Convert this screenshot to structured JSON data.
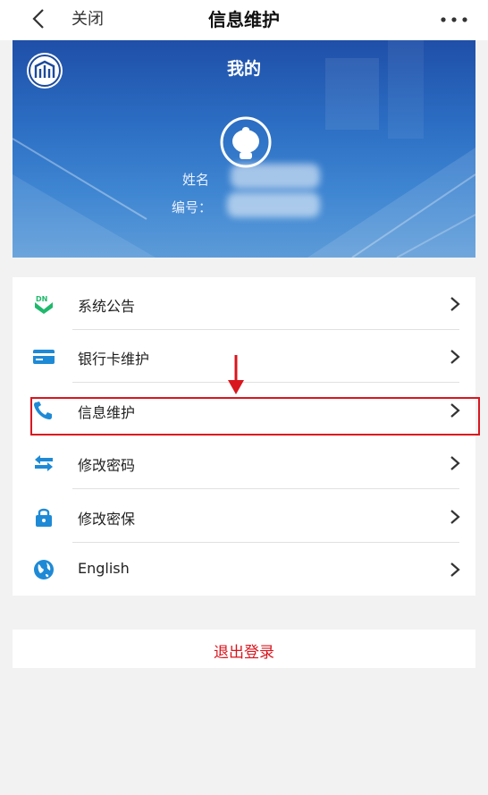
{
  "nav": {
    "close_label": "关闭",
    "title": "信息维护"
  },
  "profile": {
    "banner_title": "我的",
    "name_label": "姓名",
    "code_label": "编号："
  },
  "menu": [
    {
      "label": "系统公告",
      "icon": "announcement-icon"
    },
    {
      "label": "银行卡维护",
      "icon": "bank-card-icon"
    },
    {
      "label": "信息维护",
      "icon": "phone-icon"
    },
    {
      "label": "修改密码",
      "icon": "swap-arrows-icon"
    },
    {
      "label": "修改密保",
      "icon": "lock-icon"
    },
    {
      "label": "English",
      "icon": "globe-icon"
    }
  ],
  "logout": {
    "label": "退出登录"
  },
  "colors": {
    "accent": "#1e8ad6",
    "danger": "#d9161e",
    "banner": "#2c6fc4",
    "green": "#1fb96c"
  }
}
